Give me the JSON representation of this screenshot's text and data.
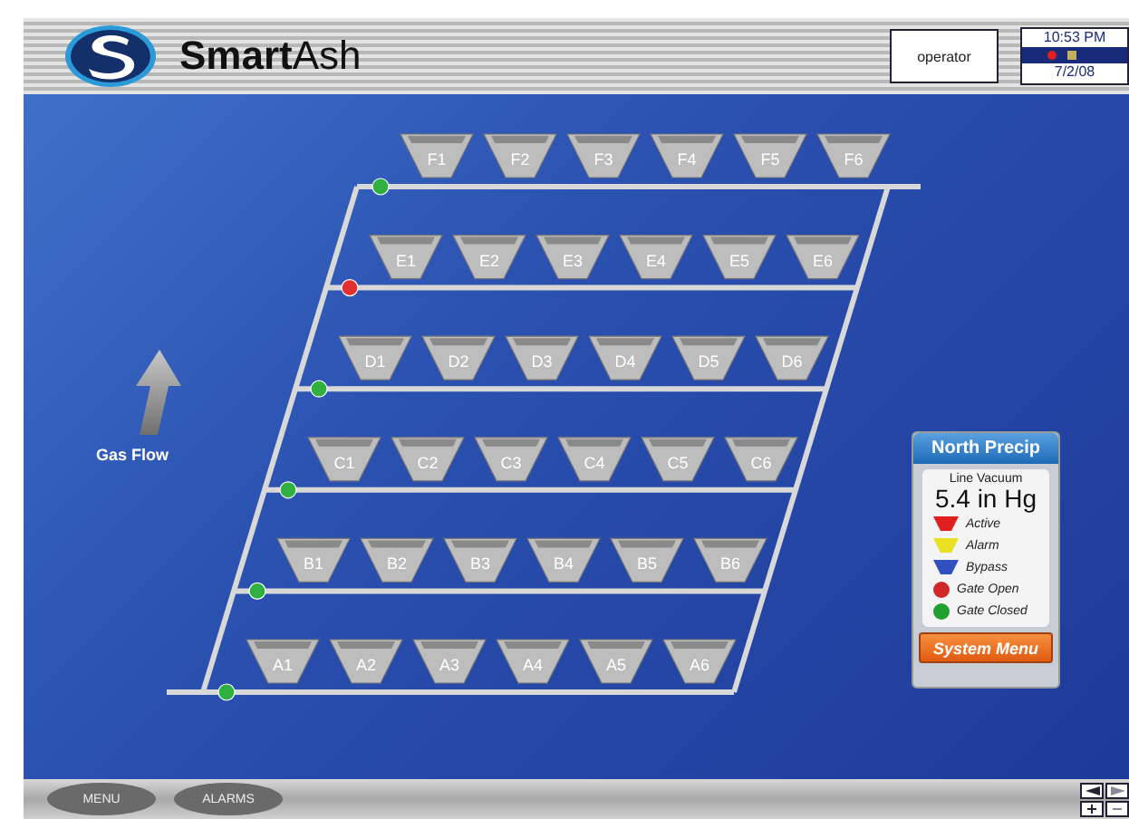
{
  "header": {
    "brand": "**Smart**Ash",
    "user": "operator",
    "time": "10:53 PM",
    "date": "7/2/08"
  },
  "diagram": {
    "flow_label": "Gas Flow",
    "rows": [
      {
        "gate_open": false,
        "hoppers": [
          "F1",
          "F2",
          "F3",
          "F4",
          "F5",
          "F6"
        ]
      },
      {
        "gate_open": true,
        "hoppers": [
          "E1",
          "E2",
          "E3",
          "E4",
          "E5",
          "E6"
        ]
      },
      {
        "gate_open": false,
        "hoppers": [
          "D1",
          "D2",
          "D3",
          "D4",
          "D5",
          "D6"
        ]
      },
      {
        "gate_open": false,
        "hoppers": [
          "C1",
          "C2",
          "C3",
          "C4",
          "C5",
          "C6"
        ]
      },
      {
        "gate_open": false,
        "hoppers": [
          "B1",
          "B2",
          "B3",
          "B4",
          "B5",
          "B6"
        ]
      },
      {
        "gate_open": false,
        "hoppers": [
          "A1",
          "A2",
          "A3",
          "A4",
          "A5",
          "A6"
        ]
      }
    ]
  },
  "panel": {
    "title": "North Precip",
    "reading_label": "Line Vacuum",
    "reading": "5.4 in Hg",
    "legend": [
      {
        "kind": "hopper",
        "color": "#e02020",
        "label": "Active"
      },
      {
        "kind": "hopper",
        "color": "#e8e020",
        "label": "Alarm"
      },
      {
        "kind": "hopper",
        "color": "#3050c0",
        "label": "Bypass"
      },
      {
        "kind": "gate",
        "color": "#d02828",
        "label": "Gate Open"
      },
      {
        "kind": "gate",
        "color": "#20a030",
        "label": "Gate Closed"
      }
    ],
    "button": "System Menu"
  },
  "footer": {
    "buttons": [
      "MENU",
      "ALARMS"
    ]
  }
}
